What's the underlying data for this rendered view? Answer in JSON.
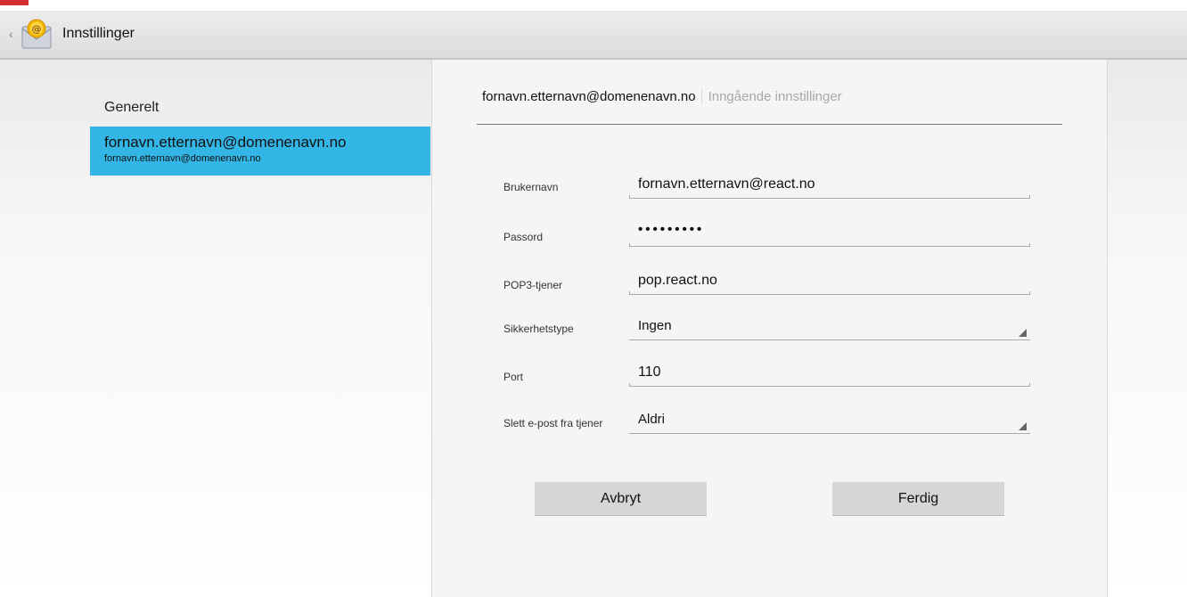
{
  "app": {
    "title": "Innstillinger",
    "icon": "email-app-icon"
  },
  "sidebar": {
    "general_label": "Generelt",
    "account": {
      "title": "fornavn.etternavn@domenenavn.no",
      "subtitle": "fornavn.etternavn@domenenavn.no"
    },
    "selected_color": "#33b5e5"
  },
  "breadcrumb": {
    "account": "fornavn.etternavn@domenenavn.no",
    "section": "Inngående innstillinger"
  },
  "form": {
    "username": {
      "label": "Brukernavn",
      "value": "fornavn.etternavn@react.no"
    },
    "password": {
      "label": "Passord",
      "value": "•••••••••"
    },
    "server": {
      "label": "POP3-tjener",
      "value": "pop.react.no"
    },
    "security": {
      "label": "Sikkerhetstype",
      "value": "Ingen"
    },
    "port": {
      "label": "Port",
      "value": "110"
    },
    "delete": {
      "label": "Slett e-post fra tjener",
      "value": "Aldri"
    }
  },
  "buttons": {
    "cancel": "Avbryt",
    "done": "Ferdig"
  }
}
